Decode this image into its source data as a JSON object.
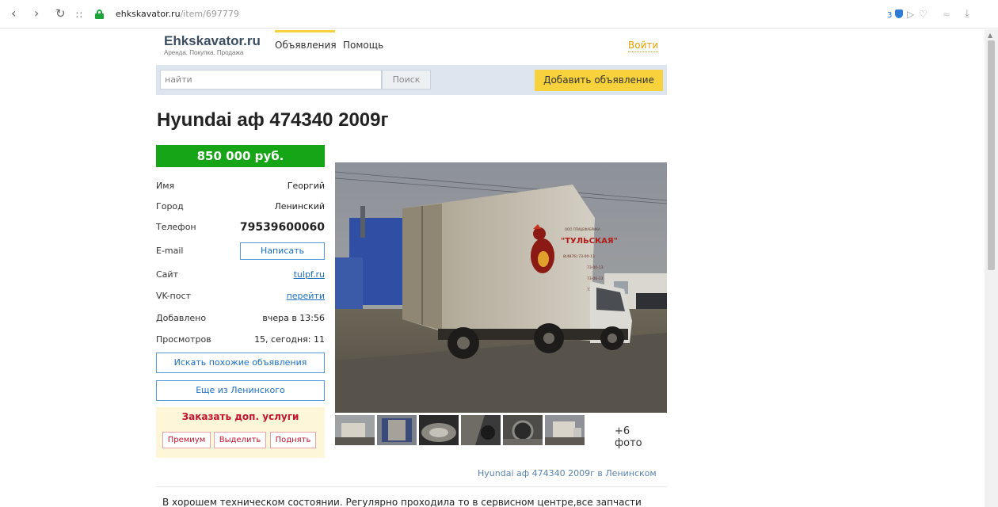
{
  "browser": {
    "url_host": "ehkskavator.ru",
    "url_path": "/item/697779",
    "ext_count": "3"
  },
  "site": {
    "logo_title": "Ehkskavator.ru",
    "logo_subtitle": "Аренда. Покупка. Продажа",
    "nav": [
      "Объявления",
      "Помощь"
    ],
    "login": "Войти",
    "search_placeholder": "найти",
    "search_button": "Поиск",
    "add_button": "Добавить объявление"
  },
  "listing": {
    "title": "Hyundai аф 474340 2009г",
    "price": "850 000 руб.",
    "info": {
      "name_label": "Имя",
      "name_value": "Георгий",
      "city_label": "Город",
      "city_value": "Ленинский",
      "phone_label": "Телефон",
      "phone_value": "79539600060",
      "email_label": "E-mail",
      "email_button": "Написать",
      "site_label": "Сайт",
      "site_value": "tulpf.ru",
      "vk_label": "VK-пост",
      "vk_value": "перейти",
      "added_label": "Добавлено",
      "added_value": "вчера в 13:56",
      "views_label": "Просмотров",
      "views_value": "15, сегодня: 11"
    },
    "similar_button": "Искать похожие объявления",
    "more_from_button": "Еще из Ленинского",
    "services_title": "Заказать доп. услуги",
    "services": [
      "Премиум",
      "Выделить",
      "Поднять"
    ],
    "more_photos": "+6 фото",
    "truck_text": {
      "company_small": "ООО ПТИЦЕФАБРИКА",
      "company": "\"ТУЛЬСКАЯ\"",
      "phones": [
        "8(4876) 73-00-13",
        "73-00-13",
        "73-00-13",
        "73-00-13"
      ]
    },
    "caption": "Hyundai аф 474340 2009г в Ленинском",
    "description": "В хорошем техническом состоянии. Регулярно проходила то в сервисном центре,все запчасти"
  },
  "colors": {
    "price_bg": "#16a516",
    "accent_yellow": "#f7d23d",
    "link_blue": "#1a6fc2",
    "services_red": "#c2142c"
  }
}
